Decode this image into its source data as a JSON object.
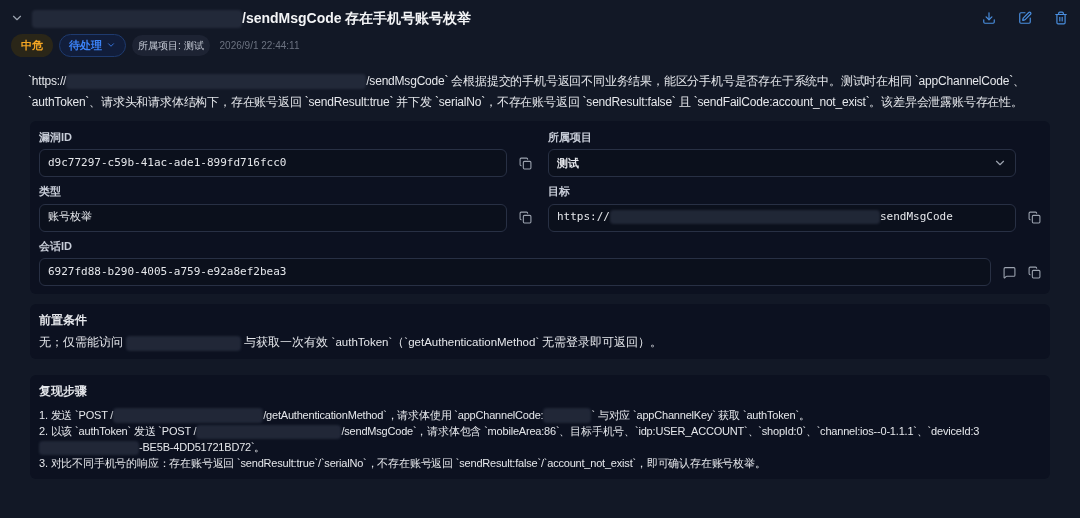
{
  "header": {
    "expanded": true,
    "title_parts": [
      {
        "kind": "redacted"
      },
      {
        "kind": "text",
        "text": "/sendMsgCode 存在手机号账号枚举"
      }
    ]
  },
  "toolbar": [
    {
      "kind": "download"
    },
    {
      "kind": "edit"
    },
    {
      "kind": "delete"
    }
  ],
  "meta": {
    "severity": {
      "text": "中危",
      "color": "#f5a623"
    },
    "status": "待处理",
    "project": "所属项目: 测试",
    "time": "2026/9/1 22:44:11"
  },
  "description": [
    {
      "kind": "text",
      "text": "`https://"
    },
    {
      "kind": "redacted"
    },
    {
      "kind": "text",
      "text": "/sendMsgCode` 会根据提交的手机号返回不同业务结果，能区分手机号是否存在于系统中。测试时在相同 `appChannelCode`、`authToken`、请求头和请求体结构下，存在账号返回 `sendResult:true` 并下发 `serialNo`，不存在账号返回 `sendResult:false` 且 `sendFailCode:account_not_exist`。该差异会泄露账号存在性。"
    }
  ],
  "fields": [
    {
      "label": "漏洞ID",
      "kind": "text",
      "value": [
        {
          "kind": "text",
          "text": "d9c77297-c59b-41ac-ade1-899fd716fcc0"
        }
      ],
      "mono": true
    },
    {
      "label": "所属项目",
      "kind": "select",
      "value": [
        {
          "kind": "text",
          "text": "测试"
        }
      ],
      "mono": false
    },
    {
      "label": "类型",
      "kind": "text",
      "value": [
        {
          "kind": "text",
          "text": "账号枚举"
        }
      ],
      "mono": true
    },
    {
      "label": "目标",
      "kind": "text",
      "value": [
        {
          "kind": "text",
          "text": "https://"
        },
        {
          "kind": "redacted"
        },
        {
          "kind": "text",
          "text": "sendMsgCode"
        }
      ],
      "mono": true
    },
    {
      "label": "会话ID",
      "kind": "session",
      "value": [
        {
          "kind": "text",
          "text": "6927fd88-b290-4005-a759-e92a8ef2bea3"
        }
      ],
      "mono": true
    }
  ],
  "precondition": {
    "heading": "前置条件",
    "parts": [
      {
        "kind": "text",
        "text": "无；仅需能访问 "
      },
      {
        "kind": "redacted"
      },
      {
        "kind": "text",
        "text": " 与获取一次有效 `authToken`（`getAuthenticationMethod` 无需登录即可返回）。"
      }
    ]
  },
  "steps": {
    "heading": "复现步骤",
    "items": [
      [
        {
          "kind": "text",
          "text": "1. 发送 `POST /"
        },
        {
          "kind": "redacted"
        },
        {
          "kind": "text",
          "text": "/getAuthenticationMethod`，请求体使用 `appChannelCode:"
        },
        {
          "kind": "redacted"
        },
        {
          "kind": "text",
          "text": "` 与对应 `appChannelKey` 获取 `authToken`。"
        }
      ],
      [
        {
          "kind": "text",
          "text": "2. 以该 `authToken` 发送 `POST /"
        },
        {
          "kind": "redacted"
        },
        {
          "kind": "text",
          "text": "/sendMsgCode`，请求体包含 `mobileArea:86`、目标手机号、`idp:USER_ACCOUNT`、`shopId:0`、`channel:ios--0-1.1.1`、`deviceId:3"
        },
        {
          "kind": "redacted"
        },
        {
          "kind": "text",
          "text": "-BE5B-4DD51721BD72`。"
        }
      ],
      [
        {
          "kind": "text",
          "text": "3. 对比不同手机号的响应：存在账号返回 `sendResult:true`/`serialNo`，不存在账号返回 `sendResult:false`/`account_not_exist`，即可确认存在账号枚举。"
        }
      ]
    ]
  }
}
